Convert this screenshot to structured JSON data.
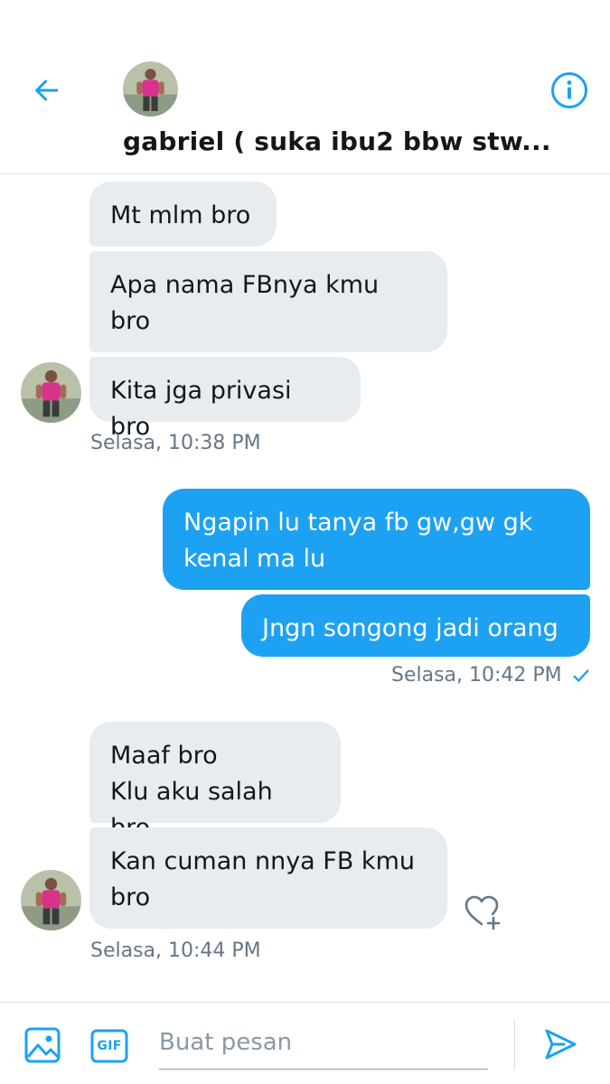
{
  "header": {
    "title": "gabriel ( suka ibu2 bbw stw...",
    "back_icon": "arrow-left-icon",
    "info_icon": "info-icon"
  },
  "messages": {
    "group1": {
      "m1": "Mt mlm bro",
      "m2": "Apa nama FBnya kmu\nbro",
      "m3": "Kita jga privasi bro",
      "time": "Selasa, 10:38 PM"
    },
    "group2": {
      "m1": "Ngapin lu tanya fb gw,gw gk\nkenal ma lu",
      "m2": "Jngn songong jadi orang",
      "time": "Selasa, 10:42 PM",
      "status_icon": "checkmark-icon"
    },
    "group3": {
      "m1": "Maaf bro\nKlu aku salah bro",
      "m2": "Kan cuman nnya FB kmu\nbro",
      "time": "Selasa, 10:44 PM",
      "reaction_icon": "heart-plus-icon"
    }
  },
  "composer": {
    "placeholder": "Buat pesan",
    "value": "",
    "gif_label": "GIF"
  },
  "colors": {
    "accent": "#1da1f2",
    "incoming_bubble": "#e6ecf0",
    "muted_text": "#657786"
  }
}
